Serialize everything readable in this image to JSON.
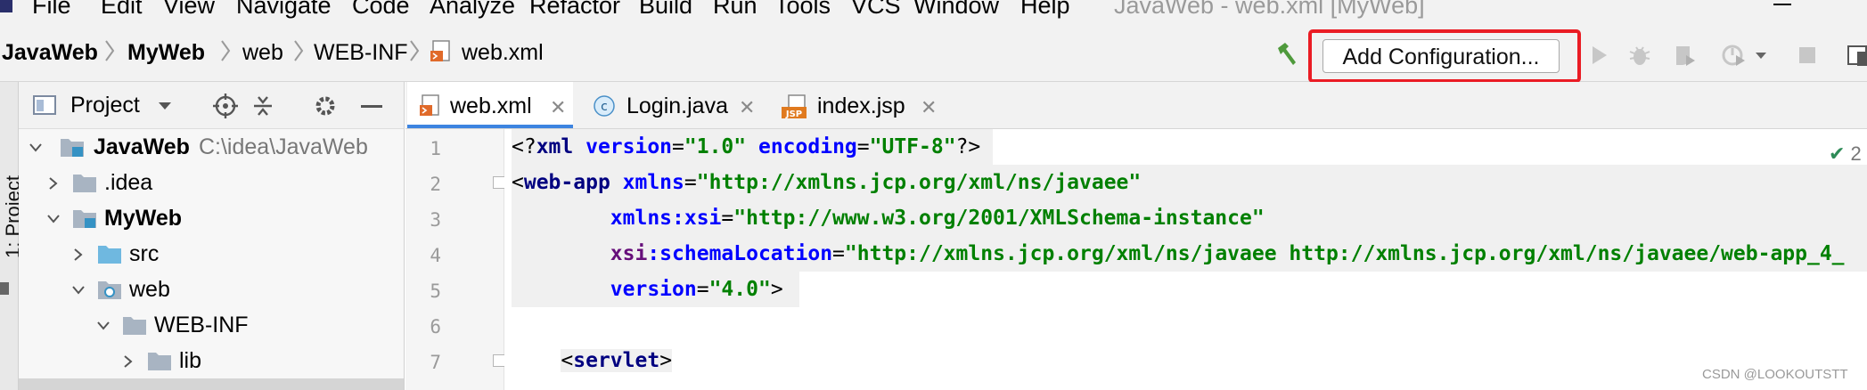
{
  "menubar": {
    "items": [
      "File",
      "Edit",
      "View",
      "Navigate",
      "Code",
      "Analyze",
      "Refactor",
      "Build",
      "Run",
      "Tools",
      "VCS",
      "Window",
      "Help"
    ],
    "window_title": "JavaWeb - web.xml [MyWeb]"
  },
  "breadcrumb": [
    "JavaWeb",
    "MyWeb",
    "web",
    "WEB-INF",
    "web.xml"
  ],
  "toolbar": {
    "add_configuration": "Add Configuration..."
  },
  "left_strip": {
    "label": "1: Project"
  },
  "project_panel": {
    "title": "Project",
    "tree": [
      {
        "name": "JavaWeb",
        "path": "C:\\idea\\JavaWeb",
        "bold": true
      },
      {
        "name": ".idea",
        "path": "",
        "bold": false
      },
      {
        "name": "MyWeb",
        "path": "",
        "bold": true
      },
      {
        "name": "src",
        "path": "",
        "bold": false
      },
      {
        "name": "web",
        "path": "",
        "bold": false
      },
      {
        "name": "WEB-INF",
        "path": "",
        "bold": false
      },
      {
        "name": "lib",
        "path": "",
        "bold": false
      }
    ]
  },
  "tabs": [
    {
      "label": "web.xml",
      "active": true,
      "icon": "xml-file-icon"
    },
    {
      "label": "Login.java",
      "active": false,
      "icon": "java-class-icon"
    },
    {
      "label": "index.jsp",
      "active": false,
      "icon": "jsp-file-icon"
    }
  ],
  "editor": {
    "line_numbers": [
      "1",
      "2",
      "3",
      "4",
      "5",
      "6",
      "7"
    ],
    "inspection_count": "2"
  },
  "watermark": "CSDN @LOOKOUTSTT",
  "colors": {
    "highlight_border": "#ea1c24",
    "active_tab": "#3d84e0",
    "string": "#008000",
    "tag": "#000080",
    "attribute": "#0000ff"
  }
}
